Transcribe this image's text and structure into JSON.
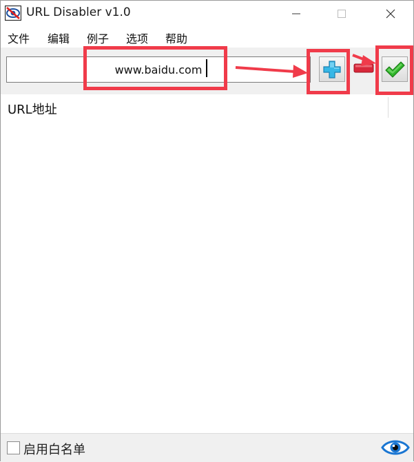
{
  "window": {
    "title": "URL Disabler v1.0",
    "app_icon": "eye-slash-icon",
    "controls": [
      "minimize-icon",
      "maximize-icon",
      "close-icon"
    ]
  },
  "menu": {
    "items": [
      {
        "label": "文件"
      },
      {
        "label": "编辑"
      },
      {
        "label": "例子"
      },
      {
        "label": "选项"
      },
      {
        "label": "帮助"
      }
    ]
  },
  "toolbar": {
    "url_value": "www.baidu.com",
    "add_icon": "plus-icon",
    "remove_icon": "minus-icon",
    "apply_icon": "checkmark-icon"
  },
  "list": {
    "column_header": "URL地址",
    "rows": []
  },
  "status": {
    "whitelist_label": "启用白名单",
    "whitelist_checked": false,
    "eye_icon": "eye-icon"
  },
  "colors": {
    "annotation": "#f03b4a",
    "add_blue": "#36b7e6",
    "remove_red": "#d8283a",
    "check_green": "#2fb52a",
    "eye_blue": "#1a76d2"
  }
}
